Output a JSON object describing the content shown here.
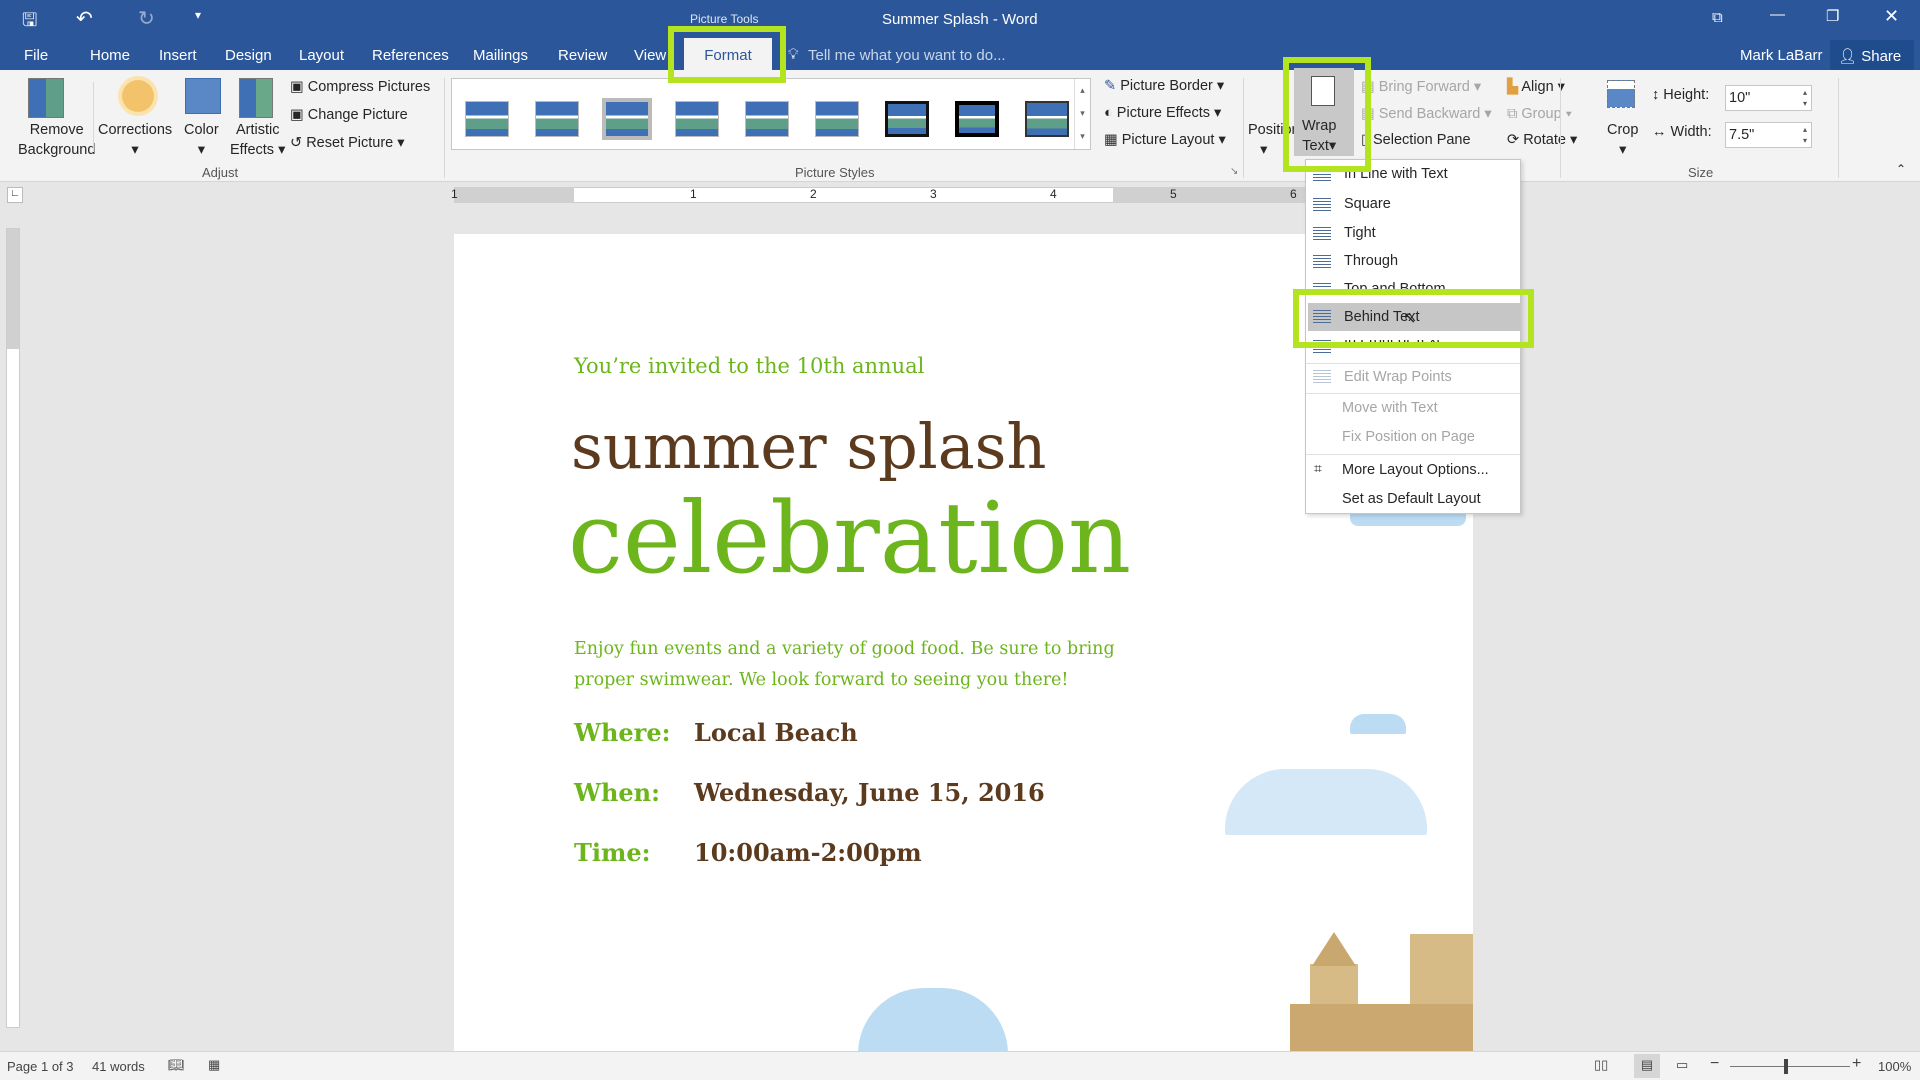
{
  "window": {
    "title": "Summer Splash - Word",
    "context_tab_group": "Picture Tools",
    "user": "Mark LaBarr",
    "share_label": "Share"
  },
  "tabs": [
    "File",
    "Home",
    "Insert",
    "Design",
    "Layout",
    "References",
    "Mailings",
    "Review",
    "View",
    "Format"
  ],
  "active_tab": "Format",
  "tell_me_placeholder": "Tell me what you want to do...",
  "ribbon": {
    "adjust": {
      "remove_background": [
        "Remove",
        "Background"
      ],
      "corrections": "Corrections",
      "color": "Color",
      "artistic_effects": [
        "Artistic",
        "Effects"
      ],
      "compress": "Compress Pictures",
      "change": "Change Picture",
      "reset": "Reset Picture",
      "group_label": "Adjust"
    },
    "picture_styles": {
      "group_label": "Picture Styles",
      "border": "Picture Border",
      "effects": "Picture Effects",
      "layout": "Picture Layout"
    },
    "arrange": {
      "position": "Position",
      "wrap_text": [
        "Wrap",
        "Text"
      ],
      "bring_forward": "Bring Forward",
      "send_backward": "Send Backward",
      "selection_pane": "Selection Pane",
      "align": "Align",
      "group": "Group",
      "rotate": "Rotate"
    },
    "size": {
      "crop": "Crop",
      "height_label": "Height:",
      "height_value": "10\"",
      "width_label": "Width:",
      "width_value": "7.5\"",
      "group_label": "Size"
    }
  },
  "wrap_menu": {
    "items": [
      {
        "label": "In Line with Text",
        "disabled": false
      },
      {
        "label": "Square",
        "disabled": false
      },
      {
        "label": "Tight",
        "disabled": false
      },
      {
        "label": "Through",
        "disabled": false
      },
      {
        "label": "Top and Bottom",
        "disabled": false
      },
      {
        "label": "Behind Text",
        "disabled": false,
        "hovered": true
      },
      {
        "label": "In Front of Text",
        "disabled": false
      },
      {
        "label": "Edit Wrap Points",
        "disabled": true
      },
      {
        "label": "Move with Text",
        "disabled": true
      },
      {
        "label": "Fix Position on Page",
        "disabled": true
      },
      {
        "label": "More Layout Options...",
        "disabled": false
      },
      {
        "label": "Set as Default Layout",
        "disabled": false
      }
    ]
  },
  "ruler_numbers": [
    "1",
    "1",
    "2",
    "3",
    "4",
    "5",
    "6"
  ],
  "document": {
    "invite": "You’re invited to the 10th annual",
    "title1": "summer splash",
    "title2": "celebration",
    "body1": "Enjoy fun events and a variety of good food. Be sure to bring",
    "body2": "proper swimwear. We look forward to seeing you there!",
    "details": [
      {
        "label": "Where:",
        "value": "Local Beach"
      },
      {
        "label": "When:",
        "value": "Wednesday, June 15, 2016"
      },
      {
        "label": "Time:",
        "value": "10:00am-2:00pm"
      }
    ]
  },
  "status": {
    "page": "Page 1 of 3",
    "words": "41 words",
    "zoom": "100%"
  },
  "colors": {
    "brand": "#2b579a",
    "highlight": "#b4e31f",
    "green_text": "#6cb51c",
    "brown_text": "#5c3a1e"
  }
}
